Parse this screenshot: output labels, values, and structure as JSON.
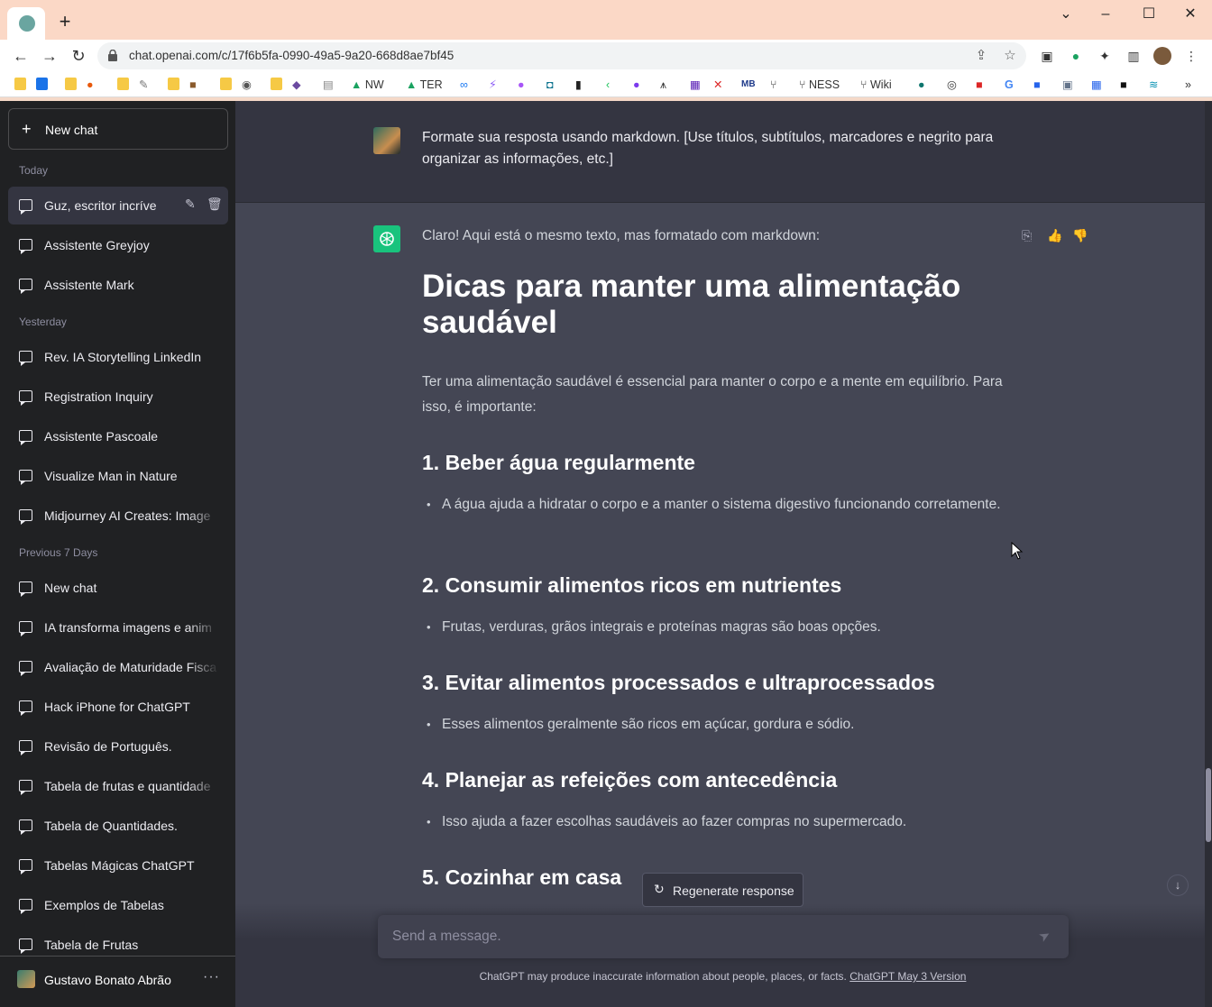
{
  "browser": {
    "url": "chat.openai.com/c/17f6b5fa-0990-49a5-9a20-668d8ae7bf45",
    "bookmarks": [
      "NW",
      "TER",
      "NESS",
      "Wiki"
    ]
  },
  "sidebar": {
    "new_chat": "New chat",
    "sections": {
      "today": "Today",
      "yesterday": "Yesterday",
      "previous": "Previous 7 Days"
    },
    "today_items": [
      "Guz, escritor incrível.",
      "Assistente Greyjoy",
      "Assistente Mark"
    ],
    "yesterday_items": [
      "Rev. IA Storytelling LinkedIn",
      "Registration Inquiry",
      "Assistente Pascoale",
      "Visualize Man in Nature",
      "Midjourney AI Creates: Image"
    ],
    "previous_items": [
      "New chat",
      "IA transforma imagens e anim",
      "Avaliação de Maturidade Fisca",
      "Hack iPhone for ChatGPT",
      "Revisão de Português.",
      "Tabela de frutas e quantidade",
      "Tabela de Quantidades.",
      "Tabelas Mágicas ChatGPT",
      "Exemplos de Tabelas",
      "Tabela de Frutas"
    ],
    "user_name": "Gustavo Bonato Abrão"
  },
  "chat": {
    "user_message": "Formate sua resposta usando markdown. [Use títulos, subtítulos, marcadores e negrito para organizar as informações, etc.]",
    "assistant_intro": "Claro! Aqui está o mesmo texto, mas formatado com markdown:",
    "title": "Dicas para manter uma alimentação saudável",
    "paragraph": "Ter uma alimentação saudável é essencial para manter o corpo e a mente em equilíbrio. Para isso, é importante:",
    "sections": [
      {
        "heading": "1. Beber água regularmente",
        "bullet": "A água ajuda a hidratar o corpo e a manter o sistema digestivo funcionando corretamente."
      },
      {
        "heading": "2. Consumir alimentos ricos em nutrientes",
        "bullet": "Frutas, verduras, grãos integrais e proteínas magras são boas opções."
      },
      {
        "heading": "3. Evitar alimentos processados e ultraprocessados",
        "bullet": "Esses alimentos geralmente são ricos em açúcar, gordura e sódio."
      },
      {
        "heading": "4. Planejar as refeições com antecedência",
        "bullet": "Isso ajuda a fazer escolhas saudáveis ao fazer compras no supermercado."
      },
      {
        "heading": "5. Cozinhar em casa"
      }
    ],
    "regenerate": "Regenerate response",
    "input_placeholder": "Send a message.",
    "footer_text": "ChatGPT may produce inaccurate information about people, places, or facts.",
    "footer_link": "ChatGPT May 3 Version"
  },
  "colors": {
    "sidebar_bg": "#202123",
    "main_bg": "#444654",
    "user_bg": "#343541",
    "accent": "#19c37d"
  }
}
